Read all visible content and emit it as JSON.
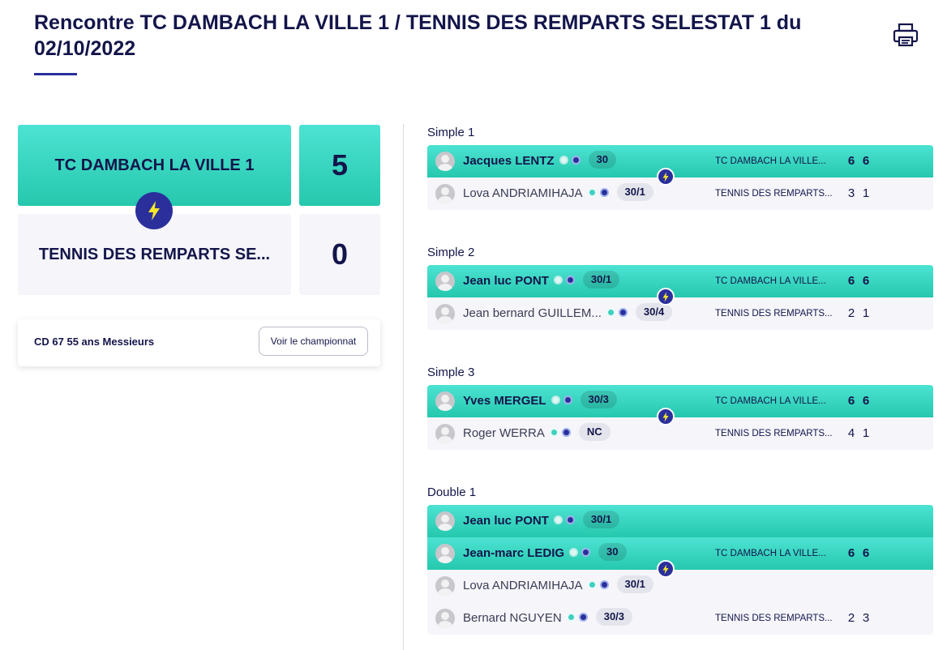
{
  "header": {
    "title": "Rencontre TC DAMBACH LA VILLE 1 / TENNIS DES REMPARTS SELESTAT 1 du 02/10/2022",
    "print_icon": "printer-icon"
  },
  "scoreboard": {
    "home": {
      "name": "TC DAMBACH LA VILLE 1",
      "score": "5"
    },
    "away": {
      "name": "TENNIS DES REMPARTS SE...",
      "score": "0"
    },
    "winner_icon": "lightning-bolt-icon"
  },
  "championship": {
    "label": "CD 67 55 ans Messieurs",
    "button_label": "Voir le championnat"
  },
  "colors": {
    "accent_teal": "#2dd4bf",
    "brand_navy": "#2a2f9c",
    "text_dark": "#13154a",
    "bolt_yellow": "#f5e72a"
  },
  "matches": [
    {
      "title": "Simple 1",
      "winner": {
        "players": [
          {
            "name": "Jacques LENTZ",
            "rank": "30"
          }
        ],
        "club": "TC DAMBACH LA VILLE...",
        "sets": [
          "6",
          "6"
        ]
      },
      "loser": {
        "players": [
          {
            "name": "Lova ANDRIAMIHAJA",
            "rank": "30/1"
          }
        ],
        "club": "TENNIS DES REMPARTS...",
        "sets": [
          "3",
          "1"
        ]
      }
    },
    {
      "title": "Simple 2",
      "winner": {
        "players": [
          {
            "name": "Jean luc PONT",
            "rank": "30/1"
          }
        ],
        "club": "TC DAMBACH LA VILLE...",
        "sets": [
          "6",
          "6"
        ]
      },
      "loser": {
        "players": [
          {
            "name": "Jean bernard GUILLEM...",
            "rank": "30/4"
          }
        ],
        "club": "TENNIS DES REMPARTS...",
        "sets": [
          "2",
          "1"
        ]
      }
    },
    {
      "title": "Simple 3",
      "winner": {
        "players": [
          {
            "name": "Yves MERGEL",
            "rank": "30/3"
          }
        ],
        "club": "TC DAMBACH LA VILLE...",
        "sets": [
          "6",
          "6"
        ]
      },
      "loser": {
        "players": [
          {
            "name": "Roger WERRA",
            "rank": "NC"
          }
        ],
        "club": "TENNIS DES REMPARTS...",
        "sets": [
          "4",
          "1"
        ]
      }
    },
    {
      "title": "Double 1",
      "winner": {
        "players": [
          {
            "name": "Jean luc PONT",
            "rank": "30/1"
          },
          {
            "name": "Jean-marc LEDIG",
            "rank": "30"
          }
        ],
        "club": "TC DAMBACH LA VILLE...",
        "sets": [
          "6",
          "6"
        ]
      },
      "loser": {
        "players": [
          {
            "name": "Lova ANDRIAMIHAJA",
            "rank": "30/1"
          },
          {
            "name": "Bernard NGUYEN",
            "rank": "30/3"
          }
        ],
        "club": "TENNIS DES REMPARTS...",
        "sets": [
          "2",
          "3"
        ]
      }
    }
  ]
}
